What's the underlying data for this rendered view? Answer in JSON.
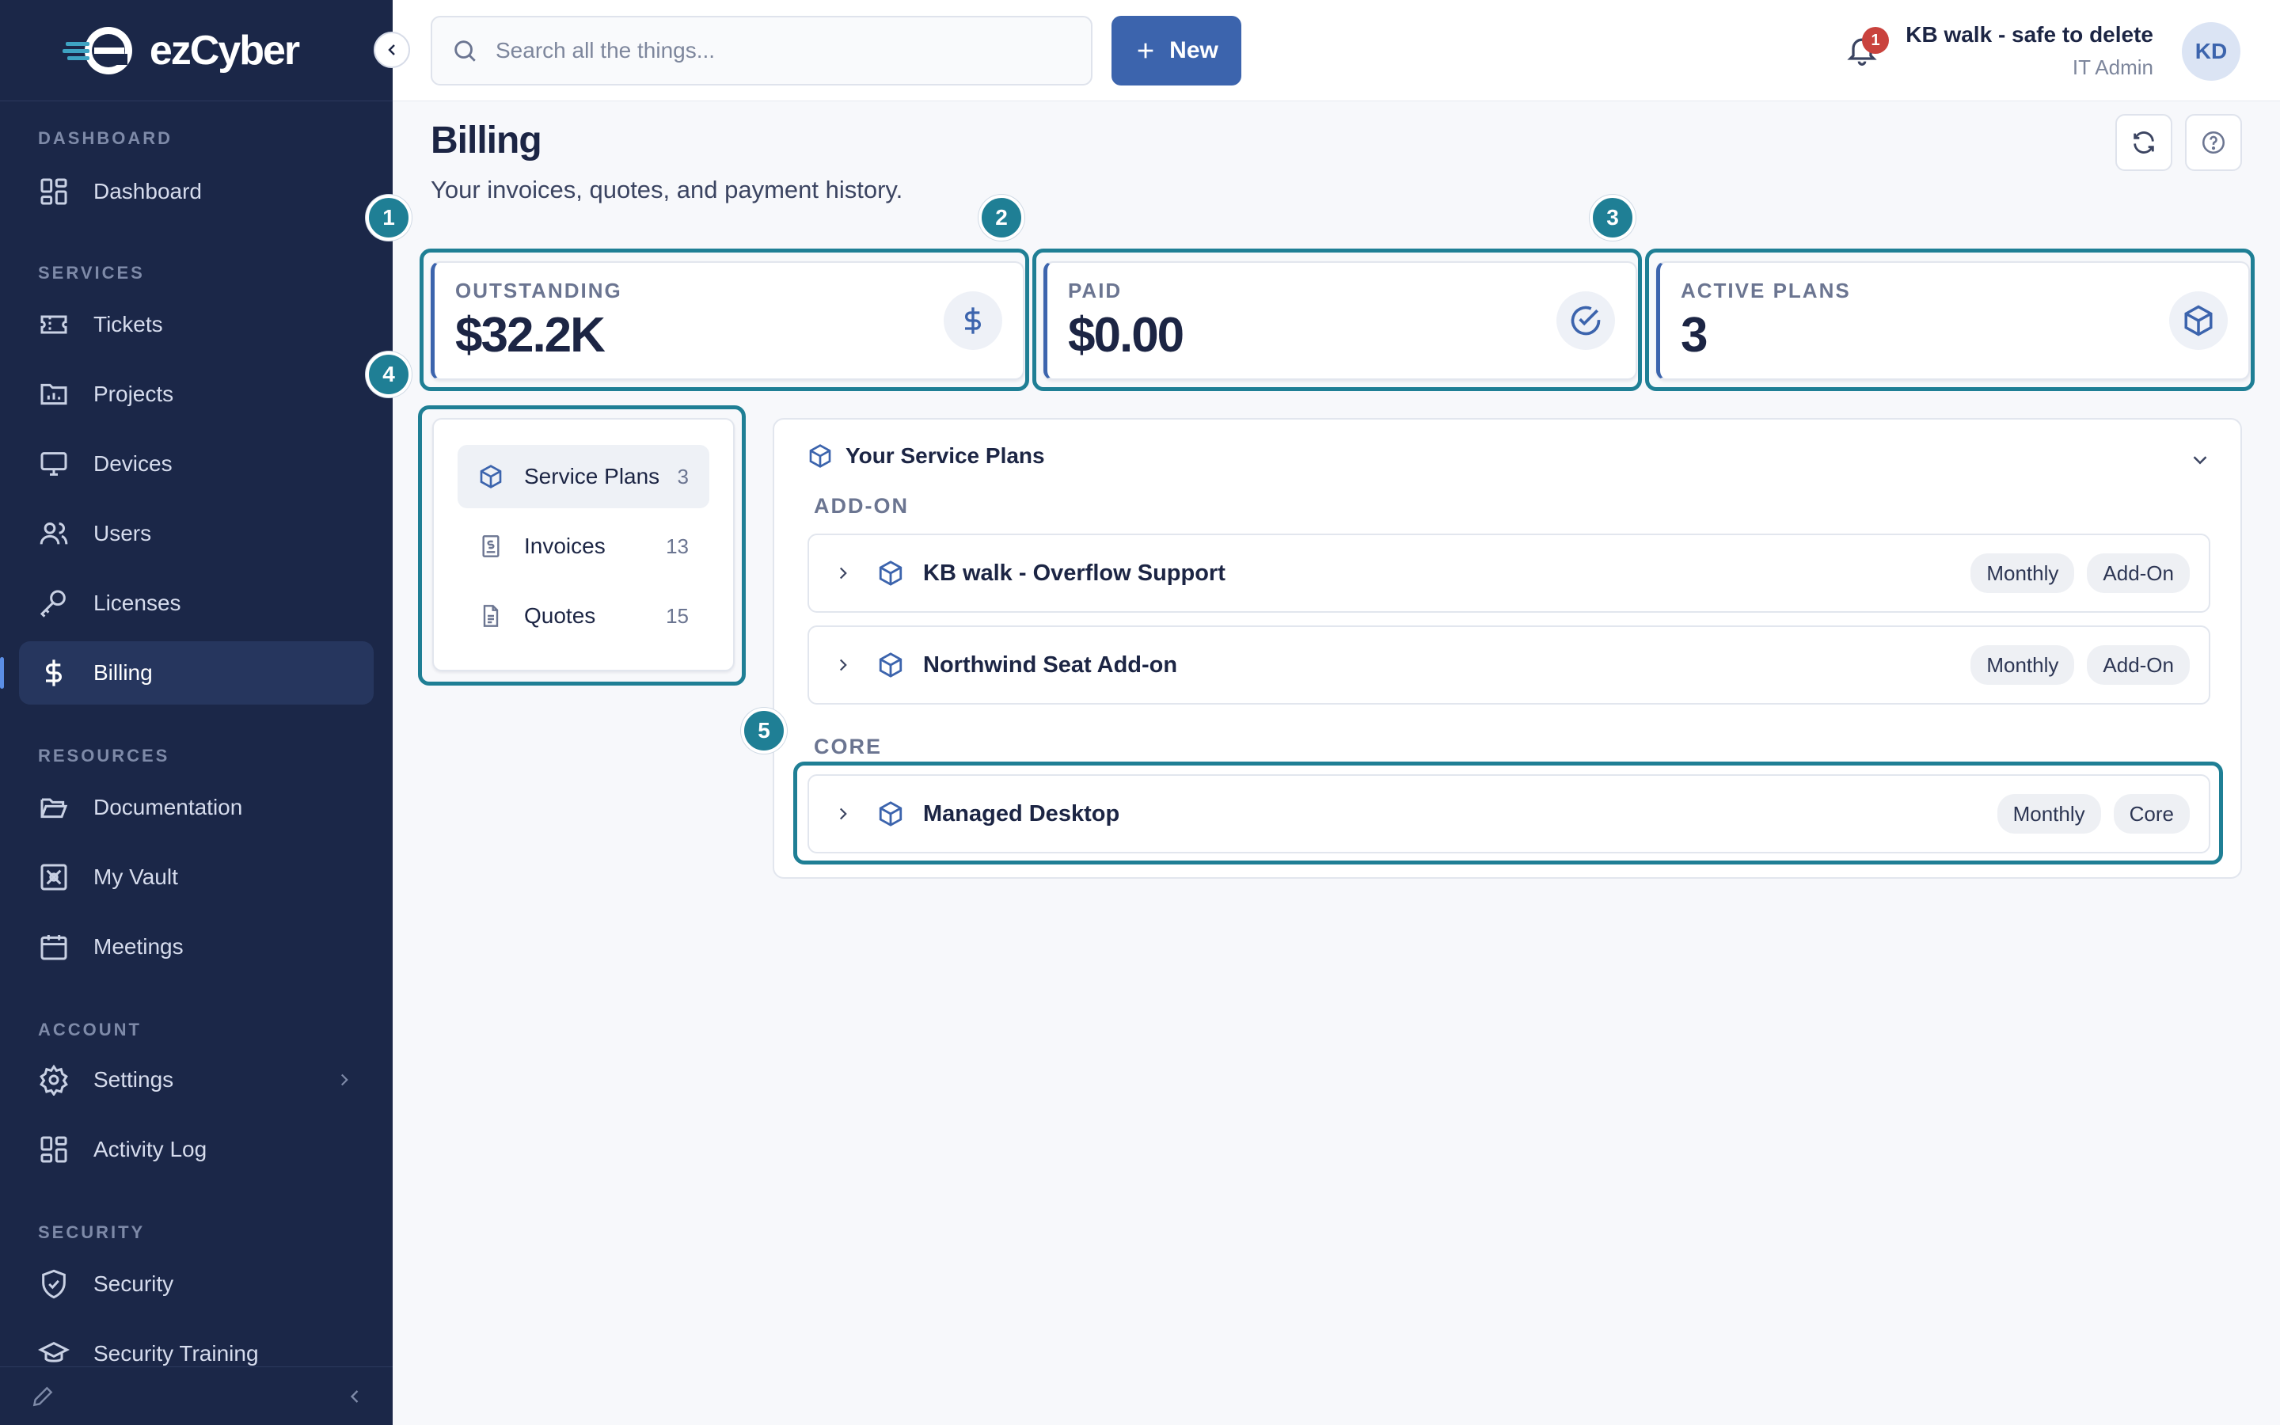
{
  "brand": {
    "name": "ezCyber"
  },
  "sidebar": {
    "sections": {
      "dashboard": "DASHBOARD",
      "services": "SERVICES",
      "resources": "RESOURCES",
      "account": "ACCOUNT",
      "security": "SECURITY"
    },
    "items": {
      "dashboard": "Dashboard",
      "tickets": "Tickets",
      "projects": "Projects",
      "devices": "Devices",
      "users": "Users",
      "licenses": "Licenses",
      "billing": "Billing",
      "documentation": "Documentation",
      "vault": "My Vault",
      "meetings": "Meetings",
      "settings": "Settings",
      "activity_log": "Activity Log",
      "security": "Security",
      "security_training": "Security Training"
    },
    "active_item": "Billing"
  },
  "topbar": {
    "search_placeholder": "Search all the things...",
    "new_label": "New",
    "notification_count": "1",
    "user_name": "KB walk - safe to delete",
    "user_role": "IT Admin",
    "avatar_initials": "KD"
  },
  "page": {
    "title": "Billing",
    "subtitle": "Your invoices, quotes, and payment history."
  },
  "annotations": [
    "1",
    "2",
    "3",
    "4",
    "5"
  ],
  "stats": {
    "outstanding": {
      "label": "OUTSTANDING",
      "value": "$32.2K",
      "icon": "dollar-icon"
    },
    "paid": {
      "label": "PAID",
      "value": "$0.00",
      "icon": "check-circle-icon"
    },
    "active_plans": {
      "label": "ACTIVE PLANS",
      "value": "3",
      "icon": "cube-icon"
    }
  },
  "tabs": [
    {
      "label": "Service Plans",
      "count": "3",
      "icon": "cube-icon",
      "active": true
    },
    {
      "label": "Invoices",
      "count": "13",
      "icon": "invoice-icon",
      "active": false
    },
    {
      "label": "Quotes",
      "count": "15",
      "icon": "document-icon",
      "active": false
    }
  ],
  "plans_panel": {
    "title": "Your Service Plans",
    "groups": [
      {
        "label": "ADD-ON",
        "plans": [
          {
            "name": "KB walk - Overflow Support",
            "tags": [
              "Monthly",
              "Add-On"
            ]
          },
          {
            "name": "Northwind Seat Add-on",
            "tags": [
              "Monthly",
              "Add-On"
            ]
          }
        ]
      },
      {
        "label": "CORE",
        "plans": [
          {
            "name": "Managed Desktop",
            "tags": [
              "Monthly",
              "Core"
            ]
          }
        ]
      }
    ]
  },
  "colors": {
    "sidebar_bg": "#1b2748",
    "accent": "#3c64ad",
    "annotation": "#1f7f95",
    "badge_red": "#c9423d"
  }
}
